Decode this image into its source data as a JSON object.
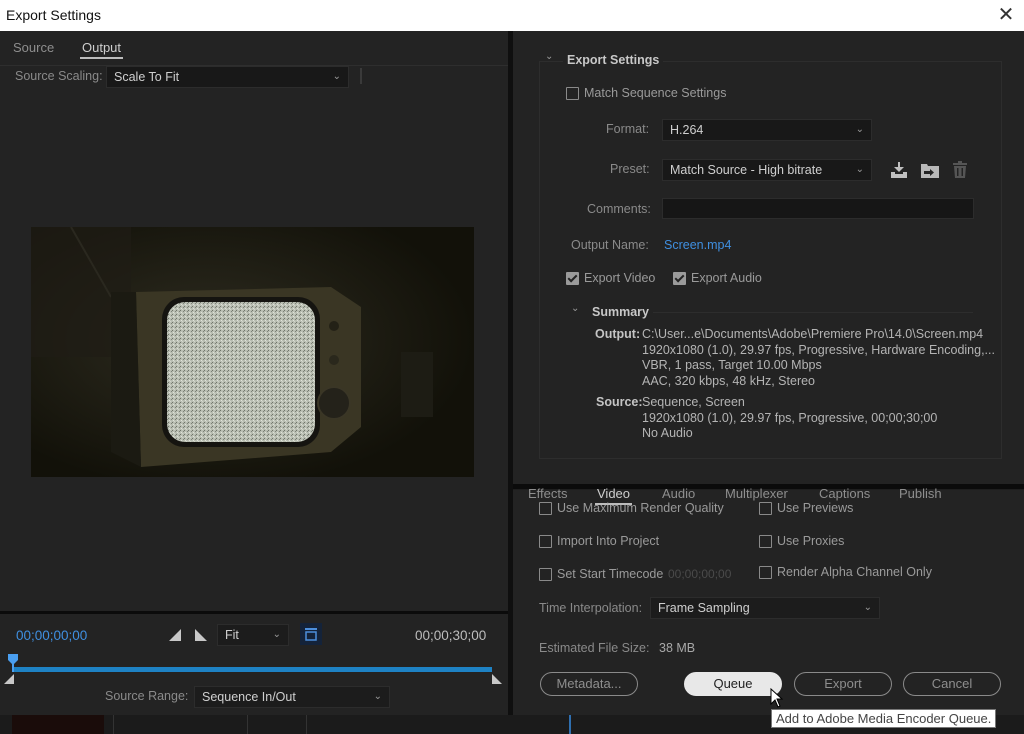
{
  "window": {
    "title": "Export Settings",
    "close_icon": "close-icon"
  },
  "left_panel": {
    "tabs": [
      {
        "label": "Source",
        "active": false
      },
      {
        "label": "Output",
        "active": true
      }
    ],
    "source_scaling": {
      "label": "Source Scaling:",
      "value": "Scale To Fit"
    },
    "preview": {
      "description": "Vintage TV showing static in dark room"
    },
    "timeline": {
      "current_timecode": "00;00;00;00",
      "end_timecode": "00;00;30;00",
      "zoom_select": "Fit",
      "playhead_position": 0,
      "source_range": {
        "label": "Source Range:",
        "value": "Sequence In/Out"
      }
    }
  },
  "export_settings": {
    "section_title": "Export Settings",
    "match_sequence": {
      "label": "Match Sequence Settings",
      "checked": false
    },
    "format": {
      "label": "Format:",
      "value": "H.264"
    },
    "preset": {
      "label": "Preset:",
      "value": "Match Source - High bitrate"
    },
    "comments": {
      "label": "Comments:",
      "value": ""
    },
    "output_name": {
      "label": "Output Name:",
      "value": "Screen.mp4"
    },
    "export_video": {
      "label": "Export Video",
      "checked": true
    },
    "export_audio": {
      "label": "Export Audio",
      "checked": true
    },
    "summary": {
      "title": "Summary",
      "output_label": "Output:",
      "output_lines": [
        "C:\\User...e\\Documents\\Adobe\\Premiere Pro\\14.0\\Screen.mp4",
        "1920x1080 (1.0), 29.97 fps, Progressive, Hardware Encoding,...",
        "VBR, 1 pass, Target 10.00 Mbps",
        "AAC, 320 kbps, 48 kHz, Stereo"
      ],
      "source_label": "Source:",
      "source_lines": [
        "Sequence, Screen",
        "1920x1080 (1.0), 29.97 fps, Progressive, 00;00;30;00",
        "No Audio"
      ]
    }
  },
  "bottom": {
    "tabs": [
      {
        "label": "Effects",
        "active": false
      },
      {
        "label": "Video",
        "active": true
      },
      {
        "label": "Audio",
        "active": false
      },
      {
        "label": "Multiplexer",
        "active": false
      },
      {
        "label": "Captions",
        "active": false
      },
      {
        "label": "Publish",
        "active": false
      }
    ],
    "options": {
      "max_render_quality": {
        "label": "Use Maximum Render Quality",
        "checked": false
      },
      "use_previews": {
        "label": "Use Previews",
        "checked": false
      },
      "import_into_project": {
        "label": "Import Into Project",
        "checked": false
      },
      "use_proxies": {
        "label": "Use Proxies",
        "checked": false
      },
      "set_start_timecode": {
        "label": "Set Start Timecode",
        "checked": false,
        "timecode": "00;00;00;00"
      },
      "render_alpha_only": {
        "label": "Render Alpha Channel Only",
        "checked": false
      }
    },
    "time_interpolation": {
      "label": "Time Interpolation:",
      "value": "Frame Sampling"
    },
    "estimated_file_size": {
      "label": "Estimated File Size:",
      "value": "38 MB"
    },
    "buttons": {
      "metadata": "Metadata...",
      "queue": "Queue",
      "export": "Export",
      "cancel": "Cancel"
    },
    "tooltip": "Add to Adobe Media Encoder Queue."
  },
  "colors": {
    "accent_blue": "#2f86d8",
    "timeline_bar": "#1e82c4",
    "link": "#3f8fe0"
  }
}
